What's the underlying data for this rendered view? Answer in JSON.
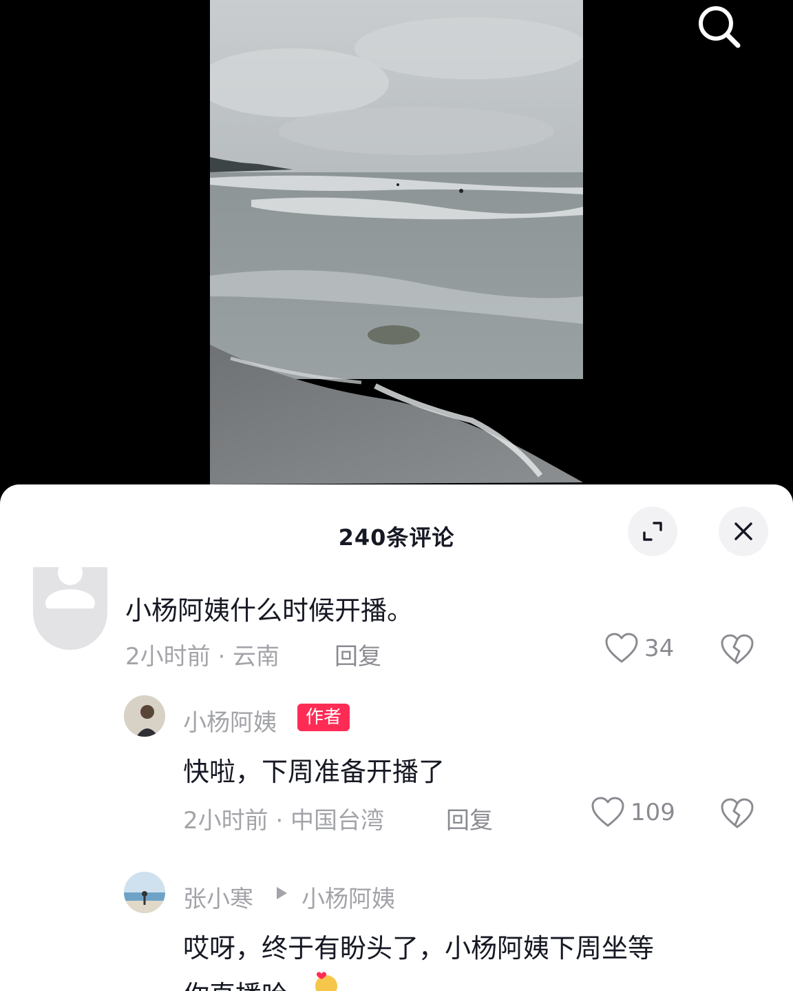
{
  "icons": {
    "search": "search-icon",
    "expand": "expand-icon",
    "close": "close-icon",
    "like": "heart-icon",
    "dislike": "broken-heart-icon",
    "reply_arrow": "play-arrow-icon",
    "emoji": "hug-emoji-icon"
  },
  "colors": {
    "badge": "#fe2c55",
    "meta": "#a3a4a9",
    "text": "#161823"
  },
  "sheet": {
    "title": "240条评论"
  },
  "comments": [
    {
      "text": "小杨阿姨什么时候开播。",
      "meta": "2小时前 · 云南",
      "reply_label": "回复",
      "likes": "34"
    },
    {
      "author": "小杨阿姨",
      "badge": "作者",
      "text": "快啦，下周准备开播了",
      "meta": "2小时前 · 中国台湾",
      "reply_label": "回复",
      "likes": "109"
    },
    {
      "author": "张小寒",
      "reply_to": "小杨阿姨",
      "text_line1": "哎呀，终于有盼头了，小杨阿姨下周坐等",
      "text_line2": "你直播哈"
    }
  ]
}
